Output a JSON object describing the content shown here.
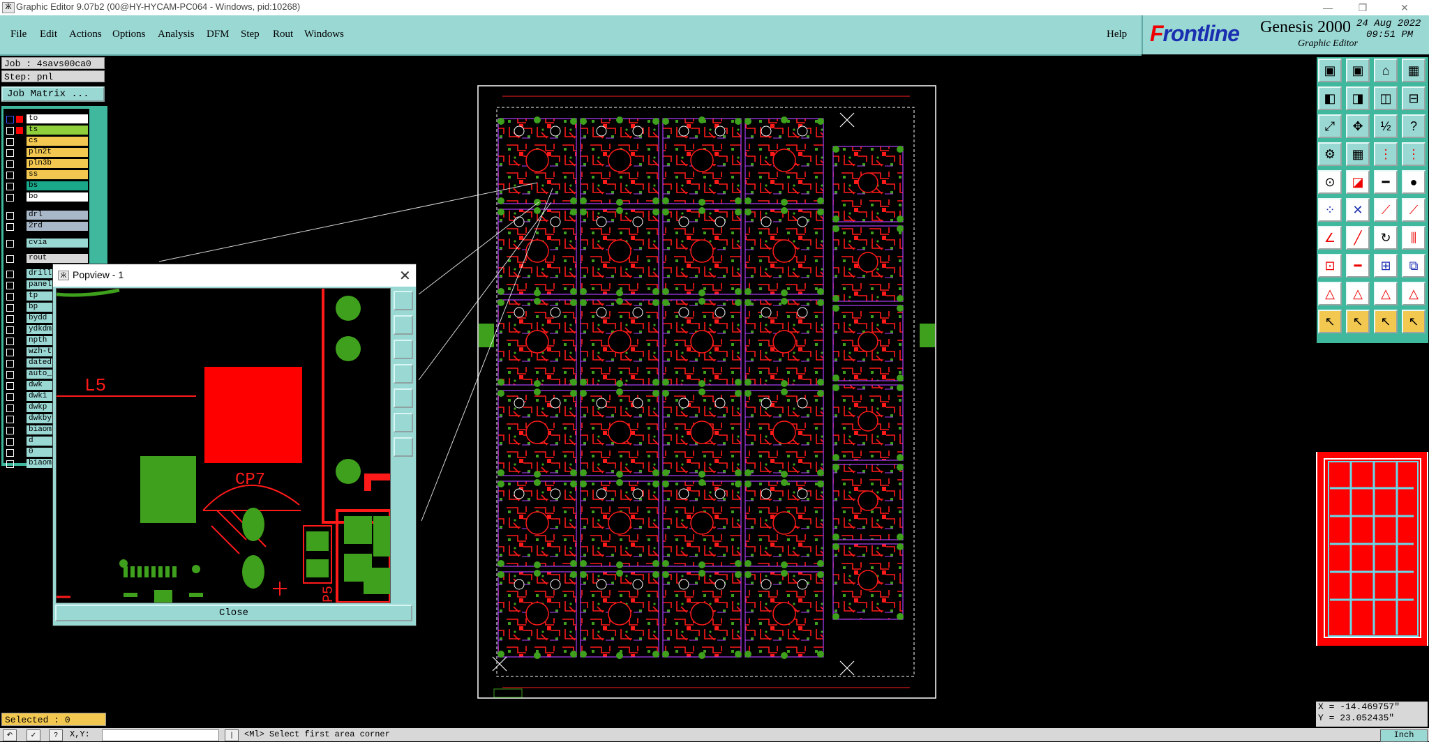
{
  "window": {
    "title": "Graphic Editor 9.07b2 (00@HY-HYCAM-PC064 - Windows, pid:10268)",
    "minimize": "—",
    "restore": "❐",
    "close": "✕"
  },
  "menu": {
    "items": [
      "File",
      "Edit",
      "Actions",
      "Options",
      "Analysis",
      "DFM",
      "Step",
      "Rout",
      "Windows"
    ],
    "help": "Help"
  },
  "brand": {
    "logo_f": "F",
    "logo_rest": "rontline",
    "title": "Genesis 2000",
    "subtitle": "Graphic Editor",
    "date": "24 Aug 2022",
    "time": "09:51 PM"
  },
  "job": {
    "job_label": "Job : 4savs00ca0",
    "step_label": "Step: pnl",
    "job_matrix": "Job Matrix ..."
  },
  "layers": [
    {
      "name": "to",
      "color": "#ffffff",
      "status": "#ff0000",
      "frame": "#3355ff"
    },
    {
      "name": "ts",
      "color": "#8fcf3c",
      "status": "#ff0000",
      "frame": "#ffffff"
    },
    {
      "name": "cs",
      "color": "#f3c850",
      "status": "",
      "frame": "#ffffff"
    },
    {
      "name": "pln2t",
      "color": "#f3c850",
      "status": "",
      "frame": "#ffffff"
    },
    {
      "name": "pln3b",
      "color": "#f3c850",
      "status": "",
      "frame": "#ffffff"
    },
    {
      "name": "ss",
      "color": "#f3c850",
      "status": "",
      "frame": "#ffffff"
    },
    {
      "name": "bs",
      "color": "#1aa88a",
      "status": "",
      "frame": "#ffffff"
    },
    {
      "name": "bo",
      "color": "#ffffff",
      "status": "",
      "frame": "#ffffff"
    },
    {
      "name": "drl",
      "color": "#a8b8c8",
      "status": "",
      "frame": "#ffffff"
    },
    {
      "name": "2rd",
      "color": "#a8b8c8",
      "status": "",
      "frame": "#ffffff"
    },
    {
      "name": "cvia",
      "color": "#9ad8d4",
      "status": "",
      "frame": "#ffffff"
    },
    {
      "name": "rout",
      "color": "#d8d8d8",
      "status": "",
      "frame": "#ffffff"
    },
    {
      "name": "drill",
      "color": "#9ad8d4",
      "status": "",
      "frame": "#ffffff"
    },
    {
      "name": "panel",
      "color": "#9ad8d4",
      "status": "",
      "frame": "#ffffff"
    },
    {
      "name": "tp",
      "color": "#9ad8d4",
      "status": "",
      "frame": "#ffffff"
    },
    {
      "name": "bp",
      "color": "#9ad8d4",
      "status": "",
      "frame": "#ffffff"
    },
    {
      "name": "bydd",
      "color": "#9ad8d4",
      "status": "",
      "frame": "#ffffff"
    },
    {
      "name": "ydkdm",
      "color": "#9ad8d4",
      "status": "",
      "frame": "#ffffff"
    },
    {
      "name": "npth",
      "color": "#9ad8d4",
      "status": "",
      "frame": "#ffffff"
    },
    {
      "name": "wzh-t",
      "color": "#9ad8d4",
      "status": "",
      "frame": "#ffffff"
    },
    {
      "name": "dated",
      "color": "#9ad8d4",
      "status": "",
      "frame": "#ffffff"
    },
    {
      "name": "auto_",
      "color": "#9ad8d4",
      "status": "",
      "frame": "#ffffff"
    },
    {
      "name": "dwk",
      "color": "#9ad8d4",
      "status": "",
      "frame": "#ffffff"
    },
    {
      "name": "dwk1",
      "color": "#9ad8d4",
      "status": "",
      "frame": "#ffffff"
    },
    {
      "name": "dwkp",
      "color": "#9ad8d4",
      "status": "",
      "frame": "#ffffff"
    },
    {
      "name": "dwkby",
      "color": "#9ad8d4",
      "status": "",
      "frame": "#ffffff"
    },
    {
      "name": "biaom",
      "color": "#9ad8d4",
      "status": "",
      "frame": "#ffffff"
    },
    {
      "name": "d",
      "color": "#9ad8d4",
      "status": "",
      "frame": "#ffffff"
    },
    {
      "name": "0",
      "color": "#9ad8d4",
      "status": "",
      "frame": "#ffffff"
    },
    {
      "name": "biaom",
      "color": "#9ad8d4",
      "status": "",
      "frame": "#ffffff"
    }
  ],
  "status": {
    "selected": "Selected : 0",
    "prompt": "<Ml>   Select first area corner",
    "coord_x": "X = -14.469757\"",
    "coord_y": "Y = 23.052435\"",
    "units_button": "Inch",
    "xy_label": "X,Y:"
  },
  "popview": {
    "title": "Popview - 1",
    "close_label": "Close",
    "label_l5": "L5",
    "label_cp7": "CP7",
    "label_p": "P5"
  },
  "colors": {
    "accent": "#9ad8d4",
    "copper_top": "#ff0000",
    "copper_green": "#3ea01c",
    "outline": "#ffffff"
  },
  "toolbar_icons": [
    "open-job-icon",
    "save-icon",
    "home-icon",
    "panes-icon",
    "window-left-icon",
    "window-right-icon",
    "window-cycle-icon",
    "window-shift-icon",
    "zoom-fit-icon",
    "zoom-home-icon",
    "zoom-ratio-icon",
    "help-query-icon",
    "measure-tool-icon",
    "grid-icon",
    "snap-red-icon",
    "snap-blue-icon",
    "view-icon",
    "layer-icon",
    "dash-icon",
    "dot-icon",
    "connect-icon",
    "cross-icon",
    "net-icon",
    "net-plus-icon",
    "angle-icon",
    "line-icon",
    "rotate-icon",
    "split-icon",
    "pad-icon",
    "minus-icon",
    "frame-icon",
    "copy-icon",
    "triangle-a-icon",
    "triangle-b-icon",
    "triangle-c-icon",
    "triangle-d-icon",
    "pointer-icon",
    "pointer-select-icon",
    "pointer-move-icon",
    "pointer-stretch-icon"
  ]
}
